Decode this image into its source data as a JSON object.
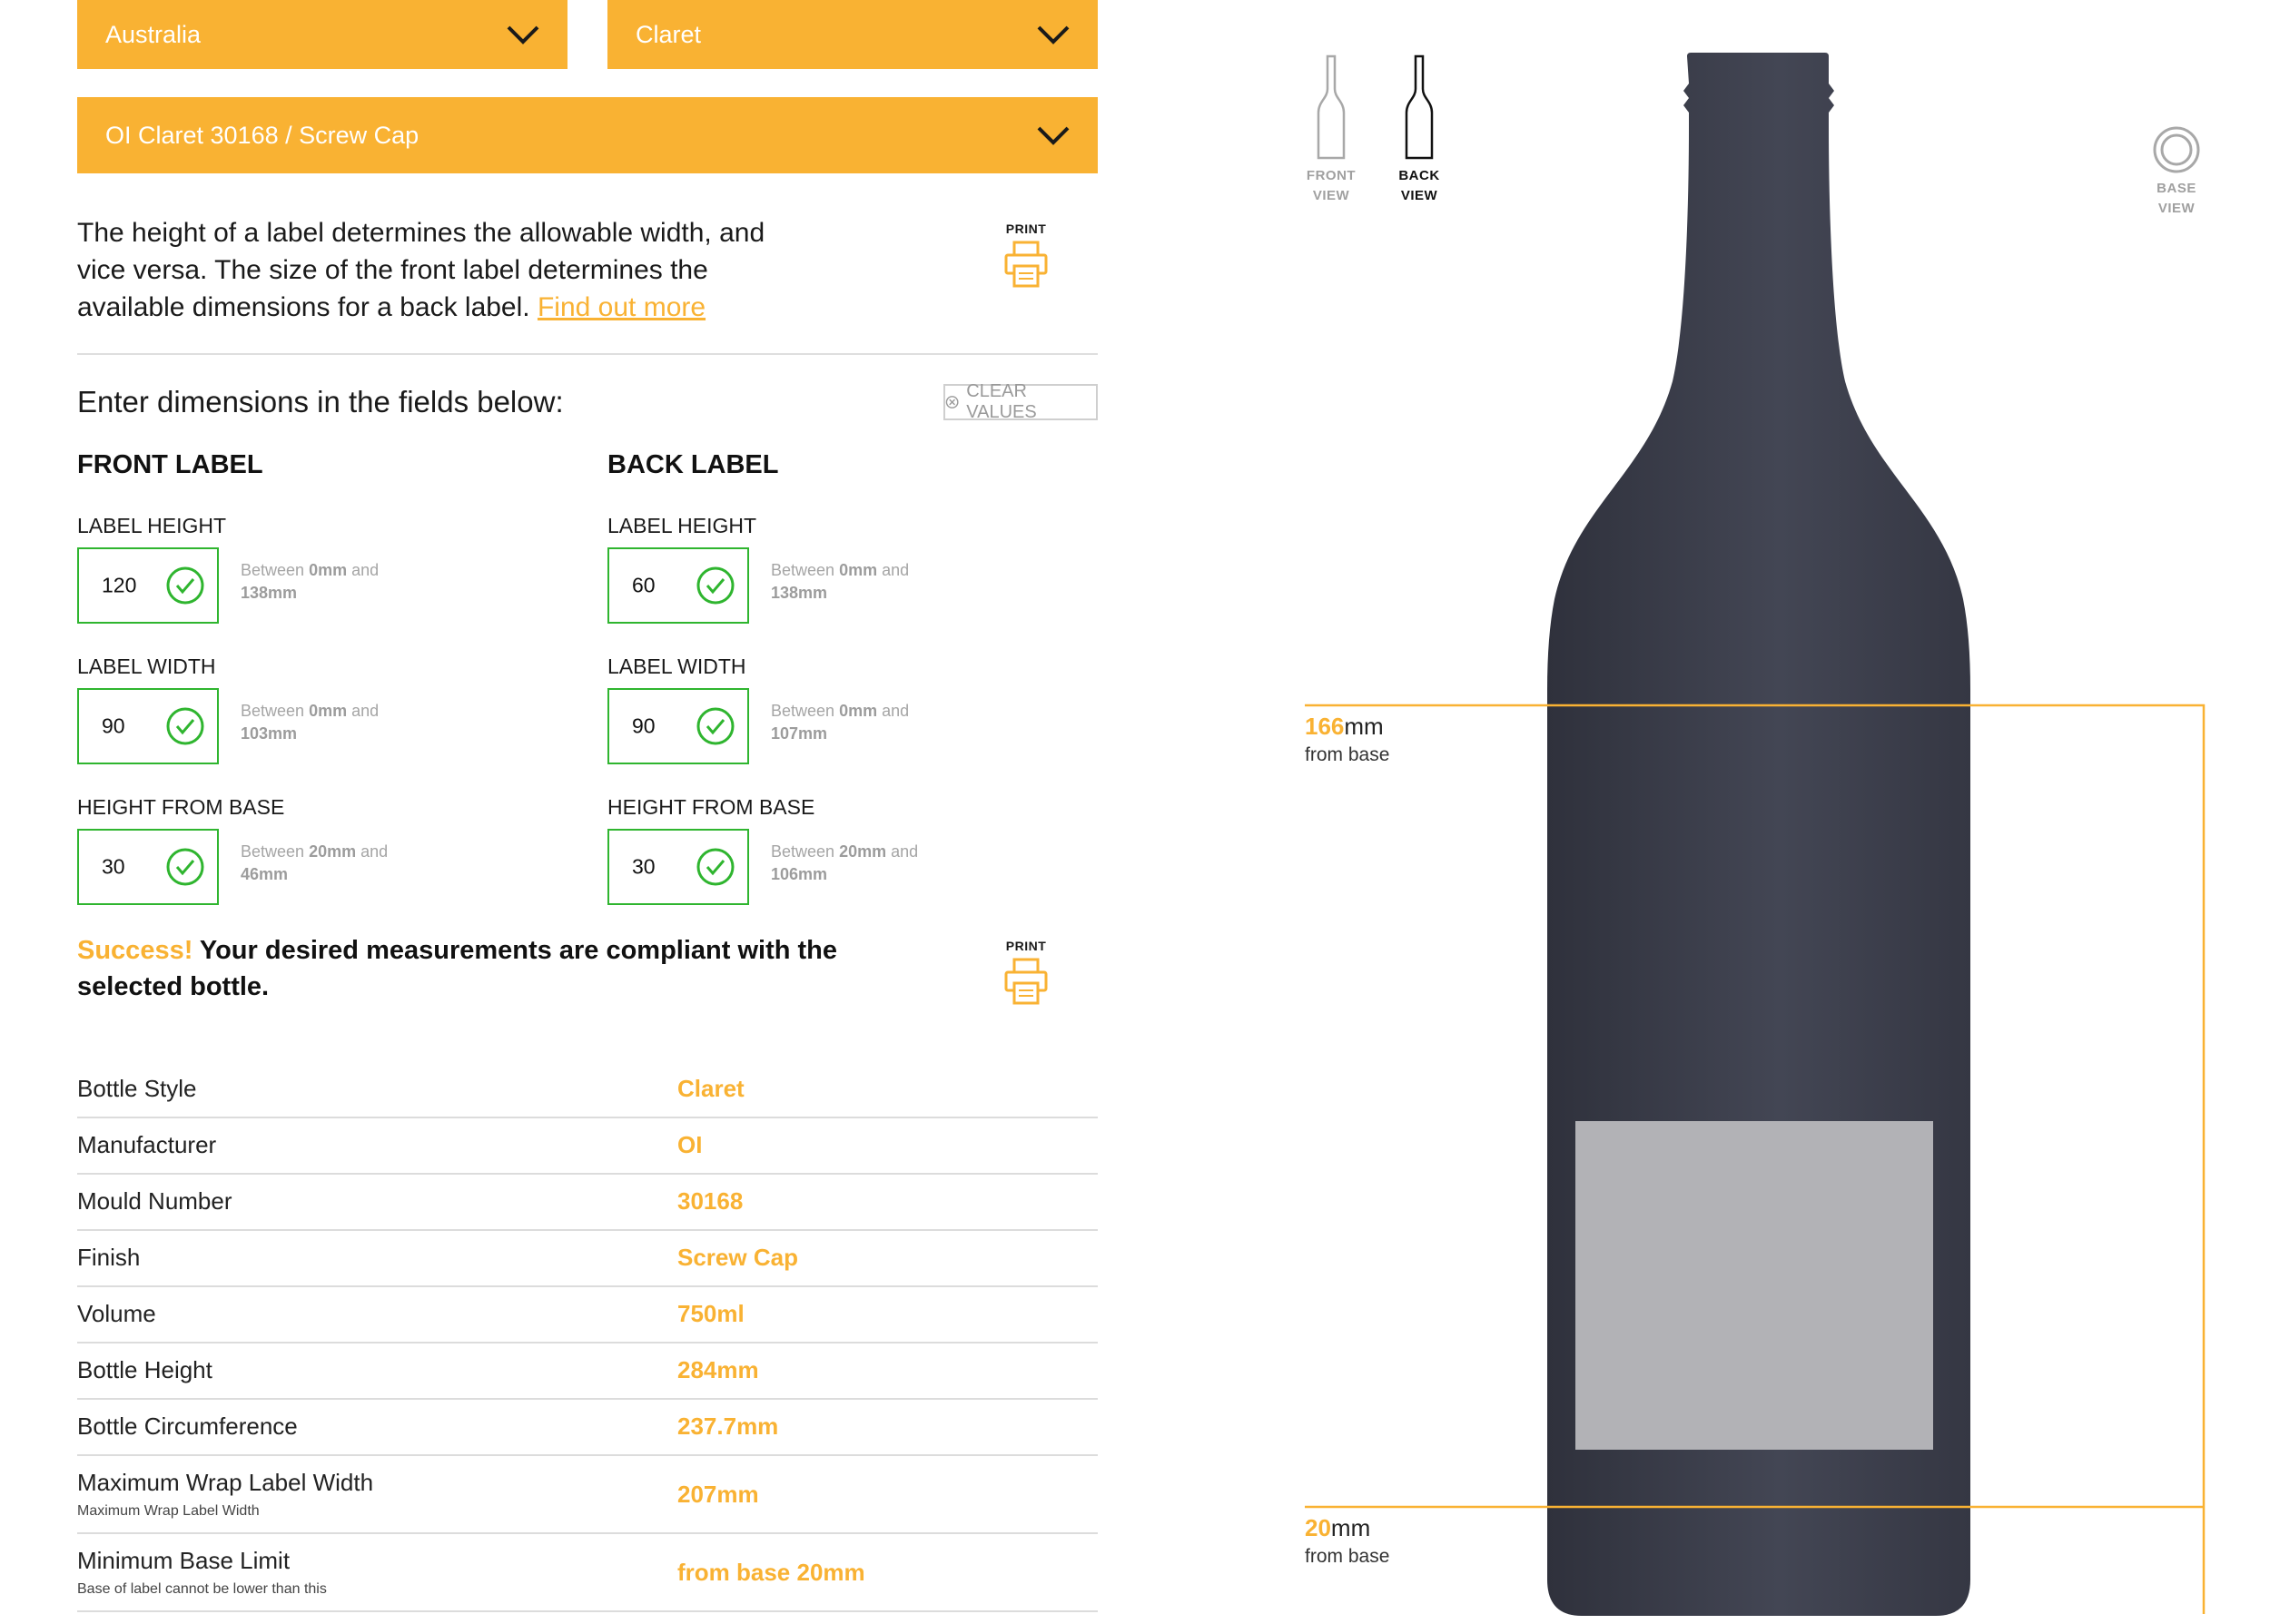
{
  "dropdowns": {
    "country": "Australia",
    "style": "Claret",
    "bottle": "OI Claret 30168 / Screw Cap"
  },
  "intro": {
    "text": "The height of a label determines the allowable width, and vice versa. The size of the front label determines the available dimensions for a back label.",
    "link": "Find out more"
  },
  "print_label": "PRINT",
  "dimensions_heading": "Enter dimensions in the fields below:",
  "clear_values": "CLEAR VALUES",
  "front_label": {
    "title": "FRONT LABEL",
    "fields": [
      {
        "label": "LABEL HEIGHT",
        "value": "120",
        "hint_pre": "Between ",
        "hint_min": "0mm",
        "hint_mid": " and",
        "hint_max": "138mm"
      },
      {
        "label": "LABEL WIDTH",
        "value": "90",
        "hint_pre": "Between ",
        "hint_min": "0mm",
        "hint_mid": " and",
        "hint_max": "103mm"
      },
      {
        "label": "HEIGHT FROM BASE",
        "value": "30",
        "hint_pre": "Between ",
        "hint_min": "20mm",
        "hint_mid": " and",
        "hint_max": "46mm"
      }
    ]
  },
  "back_label": {
    "title": "BACK LABEL",
    "fields": [
      {
        "label": "LABEL HEIGHT",
        "value": "60",
        "hint_pre": "Between ",
        "hint_min": "0mm",
        "hint_mid": " and",
        "hint_max": "138mm"
      },
      {
        "label": "LABEL WIDTH",
        "value": "90",
        "hint_pre": "Between ",
        "hint_min": "0mm",
        "hint_mid": " and",
        "hint_max": "107mm"
      },
      {
        "label": "HEIGHT FROM BASE",
        "value": "30",
        "hint_pre": "Between ",
        "hint_min": "20mm",
        "hint_mid": " and",
        "hint_max": "106mm"
      }
    ]
  },
  "success": {
    "lead": "Success!",
    "text": " Your desired measurements are compliant with the selected bottle."
  },
  "specs": [
    {
      "label": "Bottle Style",
      "value": "Claret",
      "sub": ""
    },
    {
      "label": "Manufacturer",
      "value": "OI",
      "sub": ""
    },
    {
      "label": "Mould Number",
      "value": "30168",
      "sub": ""
    },
    {
      "label": "Finish",
      "value": "Screw Cap",
      "sub": ""
    },
    {
      "label": "Volume",
      "value": "750ml",
      "sub": ""
    },
    {
      "label": "Bottle Height",
      "value": "284mm",
      "sub": ""
    },
    {
      "label": "Bottle Circumference",
      "value": "237.7mm",
      "sub": ""
    },
    {
      "label": "Maximum Wrap Label Width",
      "value": "207mm",
      "sub": "Maximum Wrap Label Width"
    },
    {
      "label": "Minimum Base Limit",
      "value": "from base 20mm",
      "sub": "Base of label cannot be lower than this"
    }
  ],
  "views": {
    "front": {
      "line1": "FRONT",
      "line2": "VIEW"
    },
    "back": {
      "line1": "BACK",
      "line2": "VIEW"
    },
    "base": {
      "line1": "BASE",
      "line2": "VIEW"
    }
  },
  "measures": {
    "top": {
      "value": "166",
      "unit": "mm",
      "sub": "from base"
    },
    "bottom": {
      "value": "20",
      "unit": "mm",
      "sub": "from base"
    }
  },
  "colors": {
    "accent": "#f9b233",
    "valid": "#2fb52f",
    "bottle": "#3b3d49",
    "label_preview": "#b2b2b6"
  }
}
